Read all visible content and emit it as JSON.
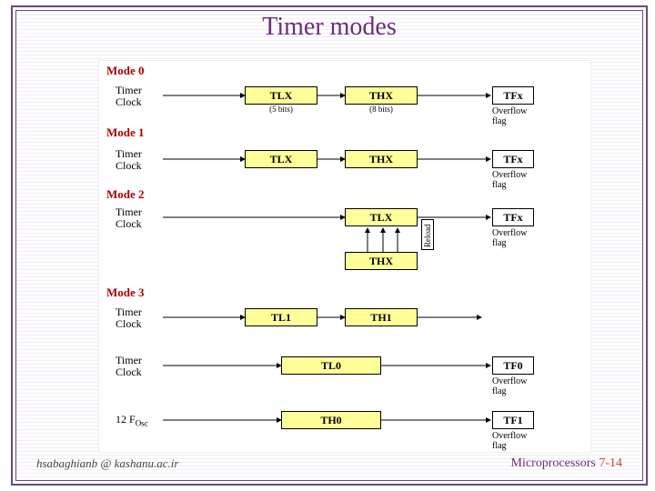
{
  "title": "Timer modes",
  "modes": {
    "m0": {
      "label": "Mode 0",
      "clock": "Timer Clock",
      "tlx": "TLX",
      "tlx_sub": "(5 bits)",
      "thx": "THX",
      "thx_sub": "(8 bits)",
      "tfx": "TFx",
      "oflow": "Overflow flag"
    },
    "m1": {
      "label": "Mode 1",
      "clock": "Timer Clock",
      "tlx": "TLX",
      "thx": "THX",
      "tfx": "TFx",
      "oflow": "Overflow flag"
    },
    "m2": {
      "label": "Mode 2",
      "clock": "Timer Clock",
      "tlx": "TLX",
      "thx": "THX",
      "reload": "Reload",
      "tfx": "TFx",
      "oflow": "Overflow flag"
    },
    "m3": {
      "label": "Mode 3",
      "row1": {
        "clock": "Timer Clock",
        "a": "TL1",
        "b": "TH1"
      },
      "row2": {
        "clock": "Timer Clock",
        "a": "TL0",
        "tf": "TF0",
        "oflow": "Overflow flag"
      },
      "row3": {
        "osc_html": "12 F<sub>Osc</sub>",
        "a": "TH0",
        "tf": "TF1",
        "oflow": "Overflow flag"
      }
    }
  },
  "footer": {
    "left": "hsabaghianb @ kashanu.ac.ir",
    "right_text": "Microprocessors ",
    "page": "7-14"
  }
}
